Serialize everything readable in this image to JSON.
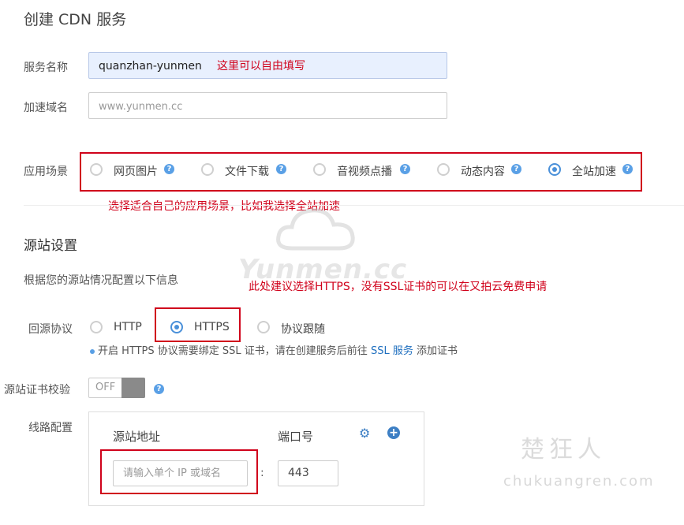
{
  "page_title": "创建 CDN 服务",
  "service_name": {
    "label": "服务名称",
    "value": "quanzhan-yunmen",
    "annotation": "这里可以自由填写"
  },
  "domain": {
    "label": "加速域名",
    "placeholder": "www.yunmen.cc"
  },
  "scenario": {
    "label": "应用场景",
    "options": [
      {
        "label": "网页图片",
        "selected": false
      },
      {
        "label": "文件下载",
        "selected": false
      },
      {
        "label": "音视频点播",
        "selected": false
      },
      {
        "label": "动态内容",
        "selected": false
      },
      {
        "label": "全站加速",
        "selected": true
      }
    ],
    "annotation": "选择适合自己的应用场景，比如我选择全站加速"
  },
  "origin": {
    "section_title": "源站设置",
    "subtitle": "根据您的源站情况配置以下信息",
    "annotation": "此处建议选择HTTPS，没有SSL证书的可以在又拍云免费申请",
    "protocol_label": "回源协议",
    "protocols": [
      {
        "label": "HTTP",
        "selected": false
      },
      {
        "label": "HTTPS",
        "selected": true
      },
      {
        "label": "协议跟随",
        "selected": false
      }
    ],
    "hint_prefix": "开启 HTTPS 协议需要绑定 SSL 证书，请在创建服务后前往 ",
    "hint_link": "SSL 服务",
    "hint_suffix": " 添加证书",
    "cert_check_label": "源站证书校验",
    "cert_check_state": "OFF",
    "route_label": "线路配置",
    "route": {
      "address_header": "源站地址",
      "port_header": "端口号",
      "address_placeholder": "请输入单个 IP 或域名",
      "separator": ":",
      "port_value": "443"
    }
  },
  "watermarks": {
    "brand": "Yunmen.cc",
    "cn": "楚狂人",
    "site": "chukuangren.com"
  },
  "colors": {
    "accent": "#4a90d9",
    "annotation_red": "#d0021b",
    "input_fill": "#e8f0fe"
  },
  "icons": {
    "help": "question-circle-icon",
    "gear": "gear-icon",
    "add": "plus-circle-icon",
    "cloud": "cloud-watermark-icon"
  }
}
